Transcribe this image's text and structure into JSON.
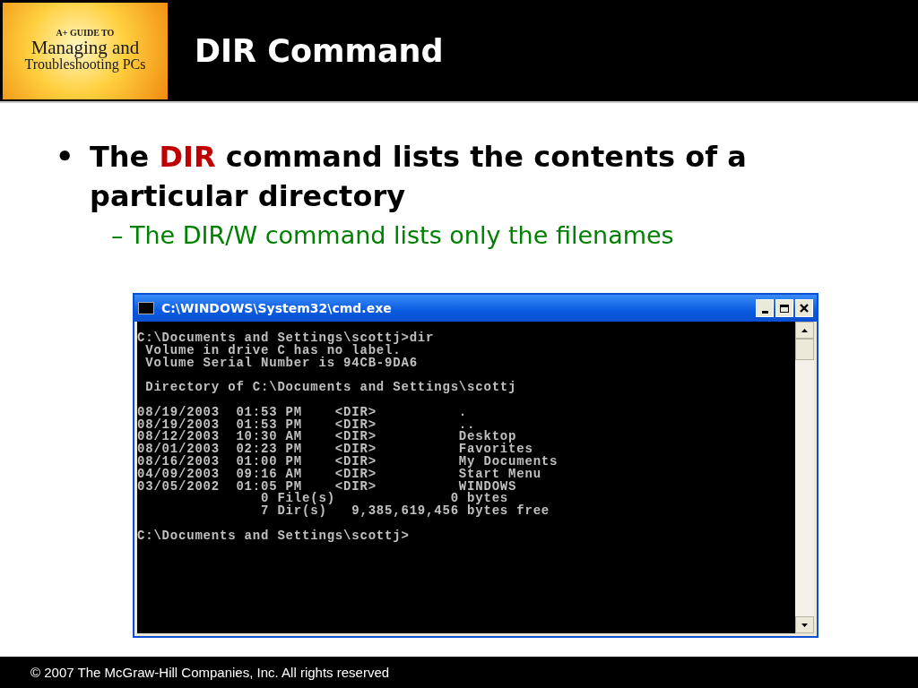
{
  "header": {
    "logo": {
      "lines": [
        "A+ GUIDE TO",
        "Managing and",
        "Troubleshooting PCs"
      ]
    },
    "title": "DIR Command"
  },
  "bullets": [
    {
      "marker": "•",
      "kind": "main",
      "parts": [
        {
          "text": "The ",
          "highlight": false
        },
        {
          "text": "DIR",
          "highlight": true
        },
        {
          "text": " command lists the contents of a particular directory",
          "highlight": false
        }
      ]
    },
    {
      "marker": "–",
      "kind": "sub",
      "parts": [
        {
          "text": "The DIR/W command lists only the filenames",
          "highlight": false
        }
      ]
    }
  ],
  "console_window": {
    "title": "C:\\WINDOWS\\System32\\cmd.exe",
    "lines": [
      {
        "text": "C:\\Documents and Settings\\scottj>dir",
        "gap_before": false
      },
      {
        "text": " Volume in drive C has no label.",
        "gap_before": false
      },
      {
        "text": " Volume Serial Number is 94CB-9DA6",
        "gap_before": false
      },
      {
        "text": " Directory of C:\\Documents and Settings\\scottj",
        "gap_before": true
      },
      {
        "text": "08/19/2003  01:53 PM    <DIR>          .",
        "gap_before": true
      },
      {
        "text": "08/19/2003  01:53 PM    <DIR>          ..",
        "gap_before": false
      },
      {
        "text": "08/12/2003  10:30 AM    <DIR>          Desktop",
        "gap_before": false
      },
      {
        "text": "08/01/2003  02:23 PM    <DIR>          Favorites",
        "gap_before": false
      },
      {
        "text": "08/16/2003  01:00 PM    <DIR>          My Documents",
        "gap_before": false
      },
      {
        "text": "04/09/2003  09:16 AM    <DIR>          Start Menu",
        "gap_before": false
      },
      {
        "text": "03/05/2002  01:05 PM    <DIR>          WINDOWS",
        "gap_before": false
      },
      {
        "text": "               0 File(s)              0 bytes",
        "gap_before": false
      },
      {
        "text": "               7 Dir(s)   9,385,619,456 bytes free",
        "gap_before": false
      },
      {
        "text": "C:\\Documents and Settings\\scottj>",
        "gap_before": true
      }
    ]
  },
  "footer": {
    "copyright": "© 2007 The McGraw-Hill Companies, Inc. All rights reserved"
  }
}
